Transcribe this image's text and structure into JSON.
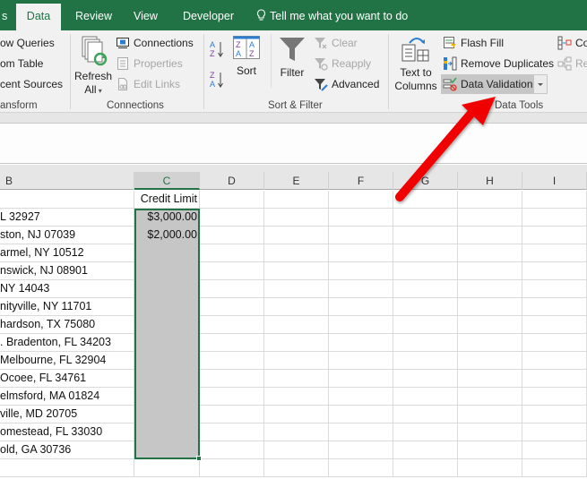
{
  "tabs": [
    {
      "label": "s",
      "active": false
    },
    {
      "label": "Data",
      "active": true
    },
    {
      "label": "Review",
      "active": false
    },
    {
      "label": "View",
      "active": false
    },
    {
      "label": "Developer",
      "active": false
    },
    {
      "label": "Tell me what you want to do",
      "active": false
    }
  ],
  "ribbon": {
    "get_transform": {
      "label": "ansform",
      "items": [
        "ow Queries",
        "om Table",
        "cent Sources"
      ]
    },
    "connections": {
      "label": "Connections",
      "refresh_all": {
        "line1": "Refresh",
        "line2": "All"
      },
      "items": [
        {
          "label": "Connections",
          "enabled": true
        },
        {
          "label": "Properties",
          "enabled": false
        },
        {
          "label": "Edit Links",
          "enabled": false
        }
      ]
    },
    "sort_filter": {
      "label": "Sort & Filter",
      "sort_az": "A→Z",
      "sort_za": "Z→A",
      "sort": "Sort",
      "filter": "Filter",
      "items": [
        {
          "label": "Clear",
          "enabled": false
        },
        {
          "label": "Reapply",
          "enabled": false
        },
        {
          "label": "Advanced",
          "enabled": true
        }
      ]
    },
    "data_tools": {
      "label": "Data Tools",
      "text_to_columns": {
        "line1": "Text to",
        "line2": "Columns"
      },
      "items": [
        {
          "label": "Flash Fill",
          "enabled": true
        },
        {
          "label": "Remove Duplicates",
          "enabled": true
        },
        {
          "label": "Data Validation",
          "enabled": true,
          "highlighted": true
        }
      ],
      "right_items": [
        {
          "label": "Co",
          "enabled": true
        },
        {
          "label": "Re",
          "enabled": false
        }
      ]
    }
  },
  "columns": [
    "B",
    "C",
    "D",
    "E",
    "F",
    "G",
    "H",
    "I"
  ],
  "selected_column": "C",
  "rows": [
    {
      "b": "",
      "c": "Credit Limit"
    },
    {
      "b": "L 32927",
      "c": "$3,000.00"
    },
    {
      "b": "ston, NJ 07039",
      "c": "$2,000.00"
    },
    {
      "b": "armel, NY 10512",
      "c": ""
    },
    {
      "b": "nswick, NJ 08901",
      "c": ""
    },
    {
      "b": " NY 14043",
      "c": ""
    },
    {
      "b": "nityville, NY 11701",
      "c": ""
    },
    {
      "b": "hardson, TX 75080",
      "c": ""
    },
    {
      "b": ". Bradenton, FL 34203",
      "c": ""
    },
    {
      "b": "Melbourne, FL 32904",
      "c": ""
    },
    {
      "b": "Ocoee, FL 34761",
      "c": ""
    },
    {
      "b": "elmsford, MA 01824",
      "c": ""
    },
    {
      "b": "ville, MD 20705",
      "c": ""
    },
    {
      "b": "omestead, FL 33030",
      "c": ""
    },
    {
      "b": "old, GA 30736",
      "c": ""
    },
    {
      "b": "",
      "c": ""
    }
  ],
  "colors": {
    "excel_green": "#217346",
    "ribbon_bg": "#f1f1f1",
    "selection_fill": "#c6c6c6",
    "annotation_arrow": "#ff0000"
  }
}
